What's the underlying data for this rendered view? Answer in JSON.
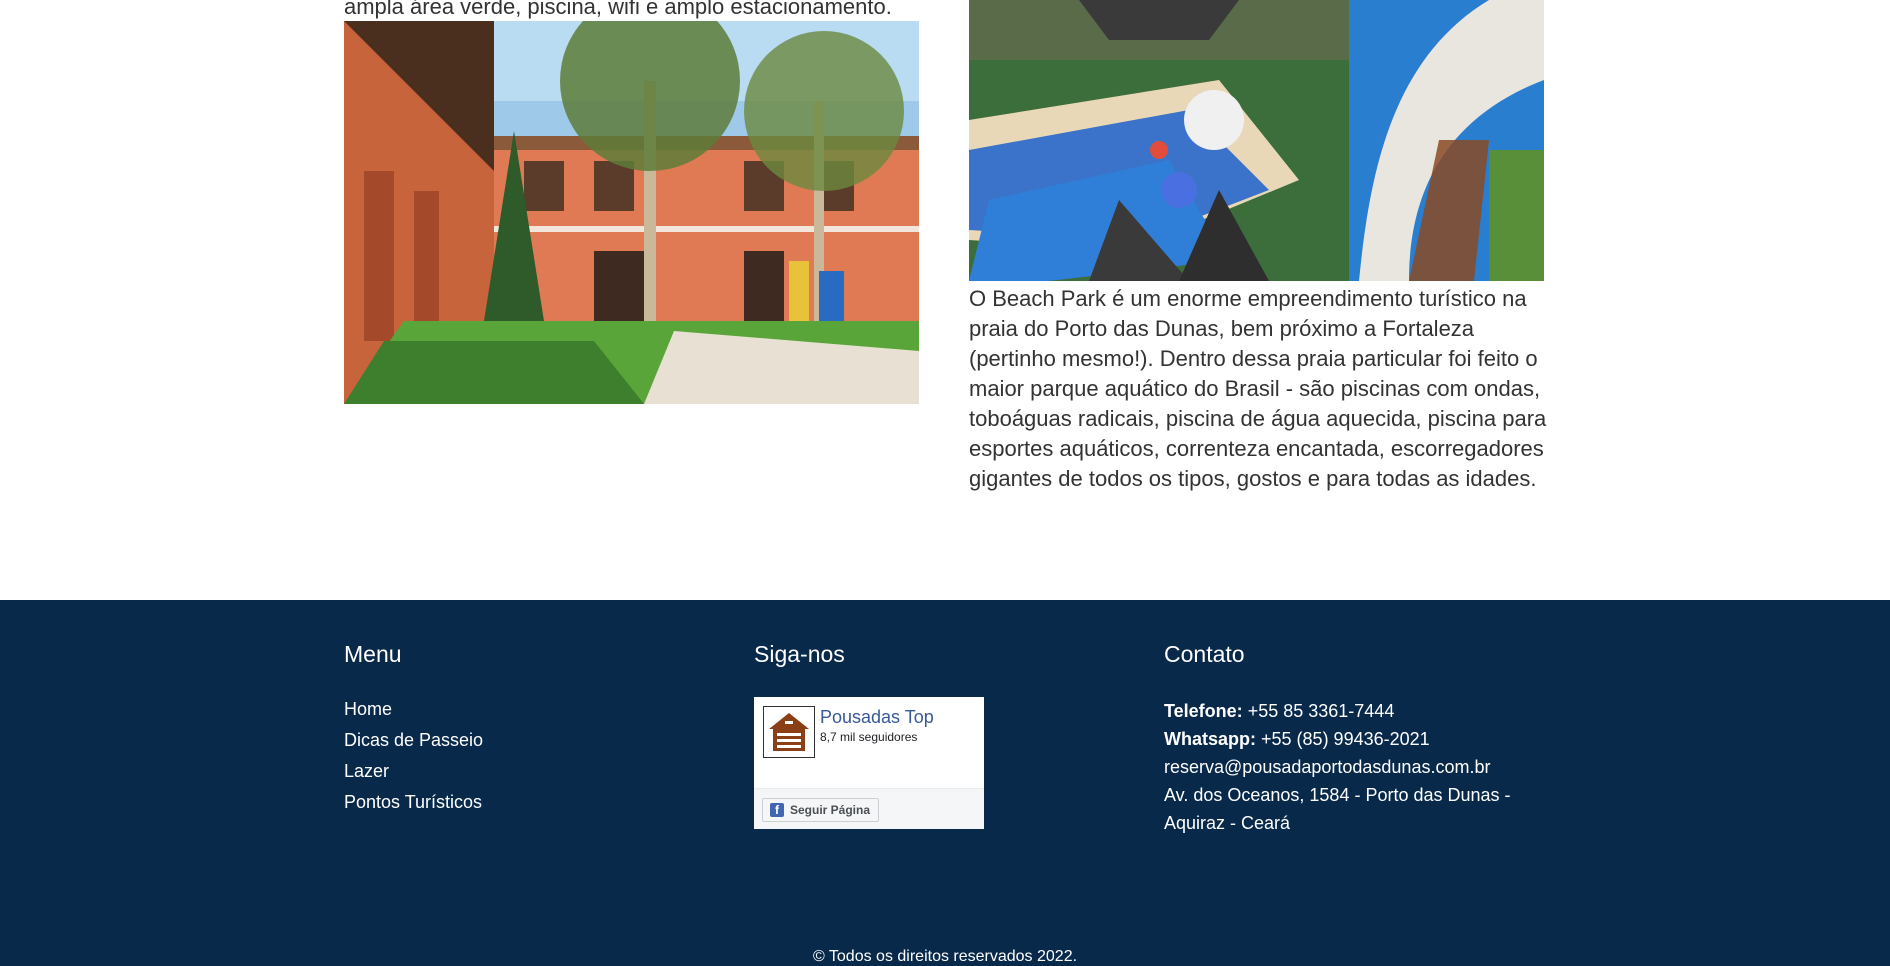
{
  "content": {
    "intro_text": "ampla área verde, piscina, wifi e amplo estacionamento.",
    "park_text": "O Beach Park é um enorme empreendimento turístico na praia do Porto das Dunas, bem próximo a Fortaleza (pertinho mesmo!). Dentro dessa praia particular foi feito o maior parque aquático do Brasil - são piscinas com ondas, toboáguas radicais, piscina de água aquecida, piscina para esportes aquáticos, correnteza encantada, escorregadores gigantes de todos os tipos, gostos e para todas as idades."
  },
  "footer": {
    "menu_title": "Menu",
    "menu_items": [
      "Home",
      "Dicas de Passeio",
      "Lazer",
      "Pontos Turísticos"
    ],
    "social_title": "Siga-nos",
    "facebook": {
      "page_name": "Pousadas Top",
      "followers": "8,7 mil seguidores",
      "follow_label": "Seguir Página",
      "icon": "cabin-logo-icon"
    },
    "contact_title": "Contato",
    "phone_label": "Telefone:",
    "phone": "+55 85 3361-7444",
    "whatsapp_label": "Whatsapp:",
    "whatsapp": "+55 (85) 99436-2021",
    "email": "reserva@pousadaportodasdunas.com.br",
    "address_line1": "Av. dos Oceanos, 1584 - Porto das Dunas -",
    "address_line2": "Aquiraz - Ceará",
    "copyright": "© Todos os direitos reservados 2022."
  },
  "colors": {
    "footer_bg": "#08294a",
    "text": "#333333"
  }
}
